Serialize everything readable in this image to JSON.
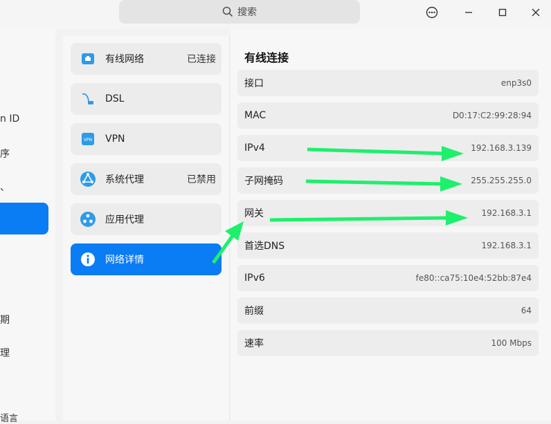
{
  "search": {
    "label": "搜索"
  },
  "window_controls": [
    "menu-icon",
    "minimize-icon",
    "maximize-icon",
    "close-icon"
  ],
  "left_nav": {
    "items": [
      {
        "label": "n ID"
      },
      {
        "label": "序"
      },
      {
        "label": "、"
      },
      {
        "label": ""
      },
      {
        "label": "期"
      },
      {
        "label": "理"
      },
      {
        "label": "语言"
      }
    ]
  },
  "network_menu": {
    "items": [
      {
        "label": "有线网络",
        "status": "已连接",
        "icon": "wired-network-icon"
      },
      {
        "label": "DSL",
        "status": "",
        "icon": "dsl-icon"
      },
      {
        "label": "VPN",
        "status": "",
        "icon": "vpn-icon"
      },
      {
        "label": "系统代理",
        "status": "已禁用",
        "icon": "system-proxy-icon"
      },
      {
        "label": "应用代理",
        "status": "",
        "icon": "app-proxy-icon"
      },
      {
        "label": "网络详情",
        "status": "",
        "icon": "info-icon",
        "selected": true
      }
    ]
  },
  "details": {
    "title": "有线连接",
    "rows": [
      {
        "key": "接口",
        "value": "enp3s0"
      },
      {
        "key": "MAC",
        "value": "D0:17:C2:99:28:94"
      },
      {
        "key": "IPv4",
        "value": "192.168.3.139"
      },
      {
        "key": "子网掩码",
        "value": "255.255.255.0"
      },
      {
        "key": "网关",
        "value": "192.168.3.1"
      },
      {
        "key": "首选DNS",
        "value": "192.168.3.1"
      },
      {
        "key": "IPv6",
        "value": "fe80::ca75:10e4:52bb:87e4"
      },
      {
        "key": "前缀",
        "value": "64"
      },
      {
        "key": "速率",
        "value": "100 Mbps"
      }
    ]
  },
  "colors": {
    "accent": "#0a7cf4",
    "annotation_arrow": "#1df06c"
  }
}
